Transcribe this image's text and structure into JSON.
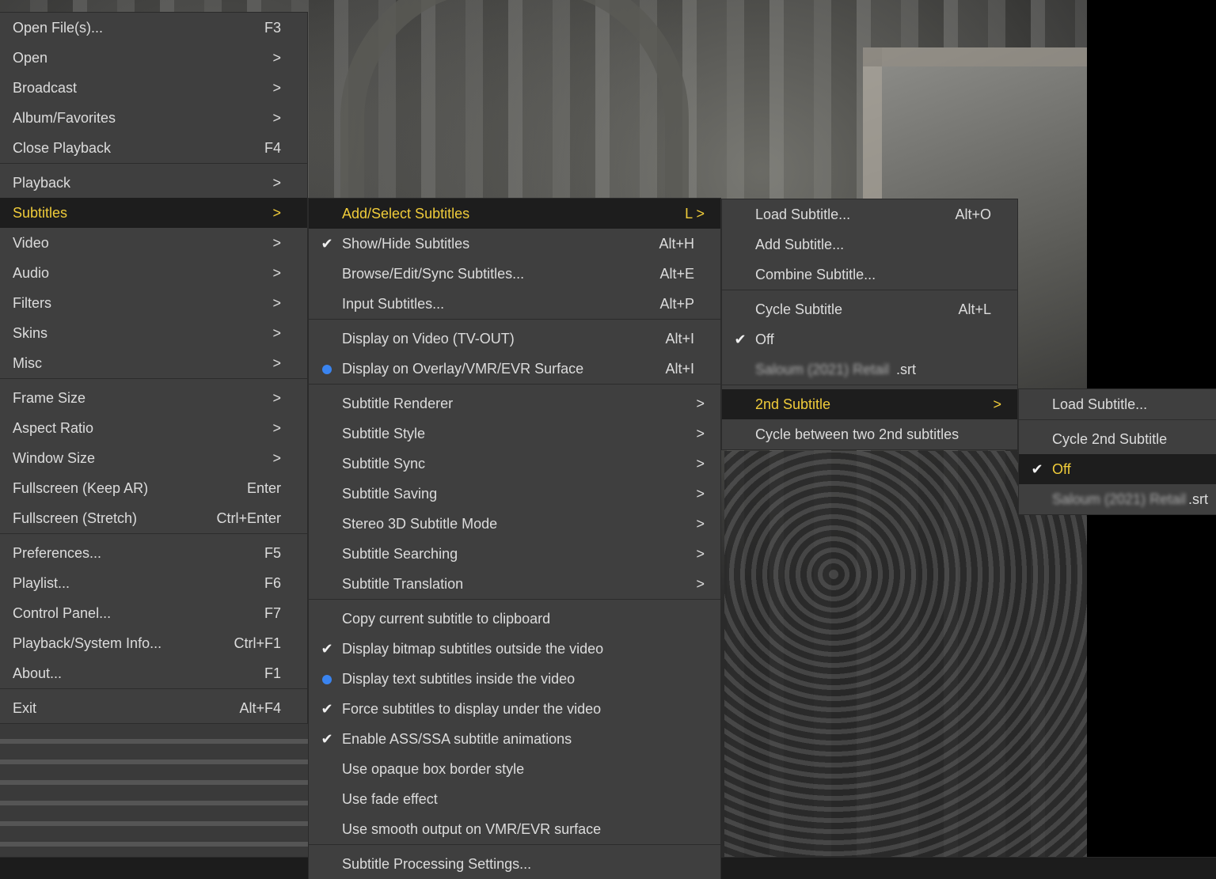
{
  "main_menu": {
    "items": [
      {
        "label": "Open File(s)...",
        "shortcut": "F3"
      },
      {
        "label": "Open",
        "arrow": ">"
      },
      {
        "label": "Broadcast",
        "arrow": ">"
      },
      {
        "label": "Album/Favorites",
        "arrow": ">"
      },
      {
        "label": "Close Playback",
        "shortcut": "F4"
      },
      {
        "label": "Playback",
        "arrow": ">"
      },
      {
        "label": "Subtitles",
        "arrow": ">"
      },
      {
        "label": "Video",
        "arrow": ">"
      },
      {
        "label": "Audio",
        "arrow": ">"
      },
      {
        "label": "Filters",
        "arrow": ">"
      },
      {
        "label": "Skins",
        "arrow": ">"
      },
      {
        "label": "Misc",
        "arrow": ">"
      },
      {
        "label": "Frame Size",
        "arrow": ">"
      },
      {
        "label": "Aspect Ratio",
        "arrow": ">"
      },
      {
        "label": "Window Size",
        "arrow": ">"
      },
      {
        "label": "Fullscreen (Keep AR)",
        "shortcut": "Enter"
      },
      {
        "label": "Fullscreen (Stretch)",
        "shortcut": "Ctrl+Enter"
      },
      {
        "label": "Preferences...",
        "shortcut": "F5"
      },
      {
        "label": "Playlist...",
        "shortcut": "F6"
      },
      {
        "label": "Control Panel...",
        "shortcut": "F7"
      },
      {
        "label": "Playback/System Info...",
        "shortcut": "Ctrl+F1"
      },
      {
        "label": "About...",
        "shortcut": "F1"
      },
      {
        "label": "Exit",
        "shortcut": "Alt+F4"
      }
    ]
  },
  "subtitles_menu": {
    "items": [
      {
        "label": "Add/Select Subtitles",
        "shortcut": "L >"
      },
      {
        "label": "Show/Hide Subtitles",
        "shortcut": "Alt+H"
      },
      {
        "label": "Browse/Edit/Sync Subtitles...",
        "shortcut": "Alt+E"
      },
      {
        "label": "Input Subtitles...",
        "shortcut": "Alt+P"
      },
      {
        "label": "Display on Video (TV-OUT)",
        "shortcut": "Alt+I"
      },
      {
        "label": "Display on Overlay/VMR/EVR Surface",
        "shortcut": "Alt+I"
      },
      {
        "label": "Subtitle Renderer",
        "arrow": ">"
      },
      {
        "label": "Subtitle Style",
        "arrow": ">"
      },
      {
        "label": "Subtitle Sync",
        "arrow": ">"
      },
      {
        "label": "Subtitle Saving",
        "arrow": ">"
      },
      {
        "label": "Stereo 3D Subtitle Mode",
        "arrow": ">"
      },
      {
        "label": "Subtitle Searching",
        "arrow": ">"
      },
      {
        "label": "Subtitle Translation",
        "arrow": ">"
      },
      {
        "label": "Copy current subtitle to clipboard"
      },
      {
        "label": "Display bitmap subtitles outside the video"
      },
      {
        "label": "Display text subtitles inside the video"
      },
      {
        "label": "Force subtitles to display under the video"
      },
      {
        "label": "Enable ASS/SSA subtitle animations"
      },
      {
        "label": "Use opaque box border style"
      },
      {
        "label": "Use fade effect"
      },
      {
        "label": "Use smooth output on VMR/EVR surface"
      },
      {
        "label": "Subtitle Processing Settings..."
      }
    ]
  },
  "add_select_menu": {
    "items": [
      {
        "label": "Load Subtitle...",
        "shortcut": "Alt+O"
      },
      {
        "label": "Add Subtitle..."
      },
      {
        "label": "Combine Subtitle..."
      },
      {
        "label": "Cycle Subtitle",
        "shortcut": "Alt+L"
      },
      {
        "label": "Off"
      },
      {
        "label": "Saloum (2021) Retail",
        "suffix": ".srt"
      },
      {
        "label": "2nd Subtitle",
        "arrow": ">"
      },
      {
        "label": "Cycle between two 2nd subtitles"
      }
    ]
  },
  "second_subtitle_menu": {
    "items": [
      {
        "label": "Load Subtitle..."
      },
      {
        "label": "Cycle 2nd Subtitle"
      },
      {
        "label": "Off"
      },
      {
        "label": "Saloum (2021) Retail",
        "suffix": ".srt"
      }
    ]
  },
  "colors": {
    "menu_bg": "#3f3f3f",
    "highlight_bg": "#1d1d1d",
    "highlight_text": "#f0cc3a",
    "text": "#dcdcdc",
    "radio_dot": "#3a84f0"
  }
}
